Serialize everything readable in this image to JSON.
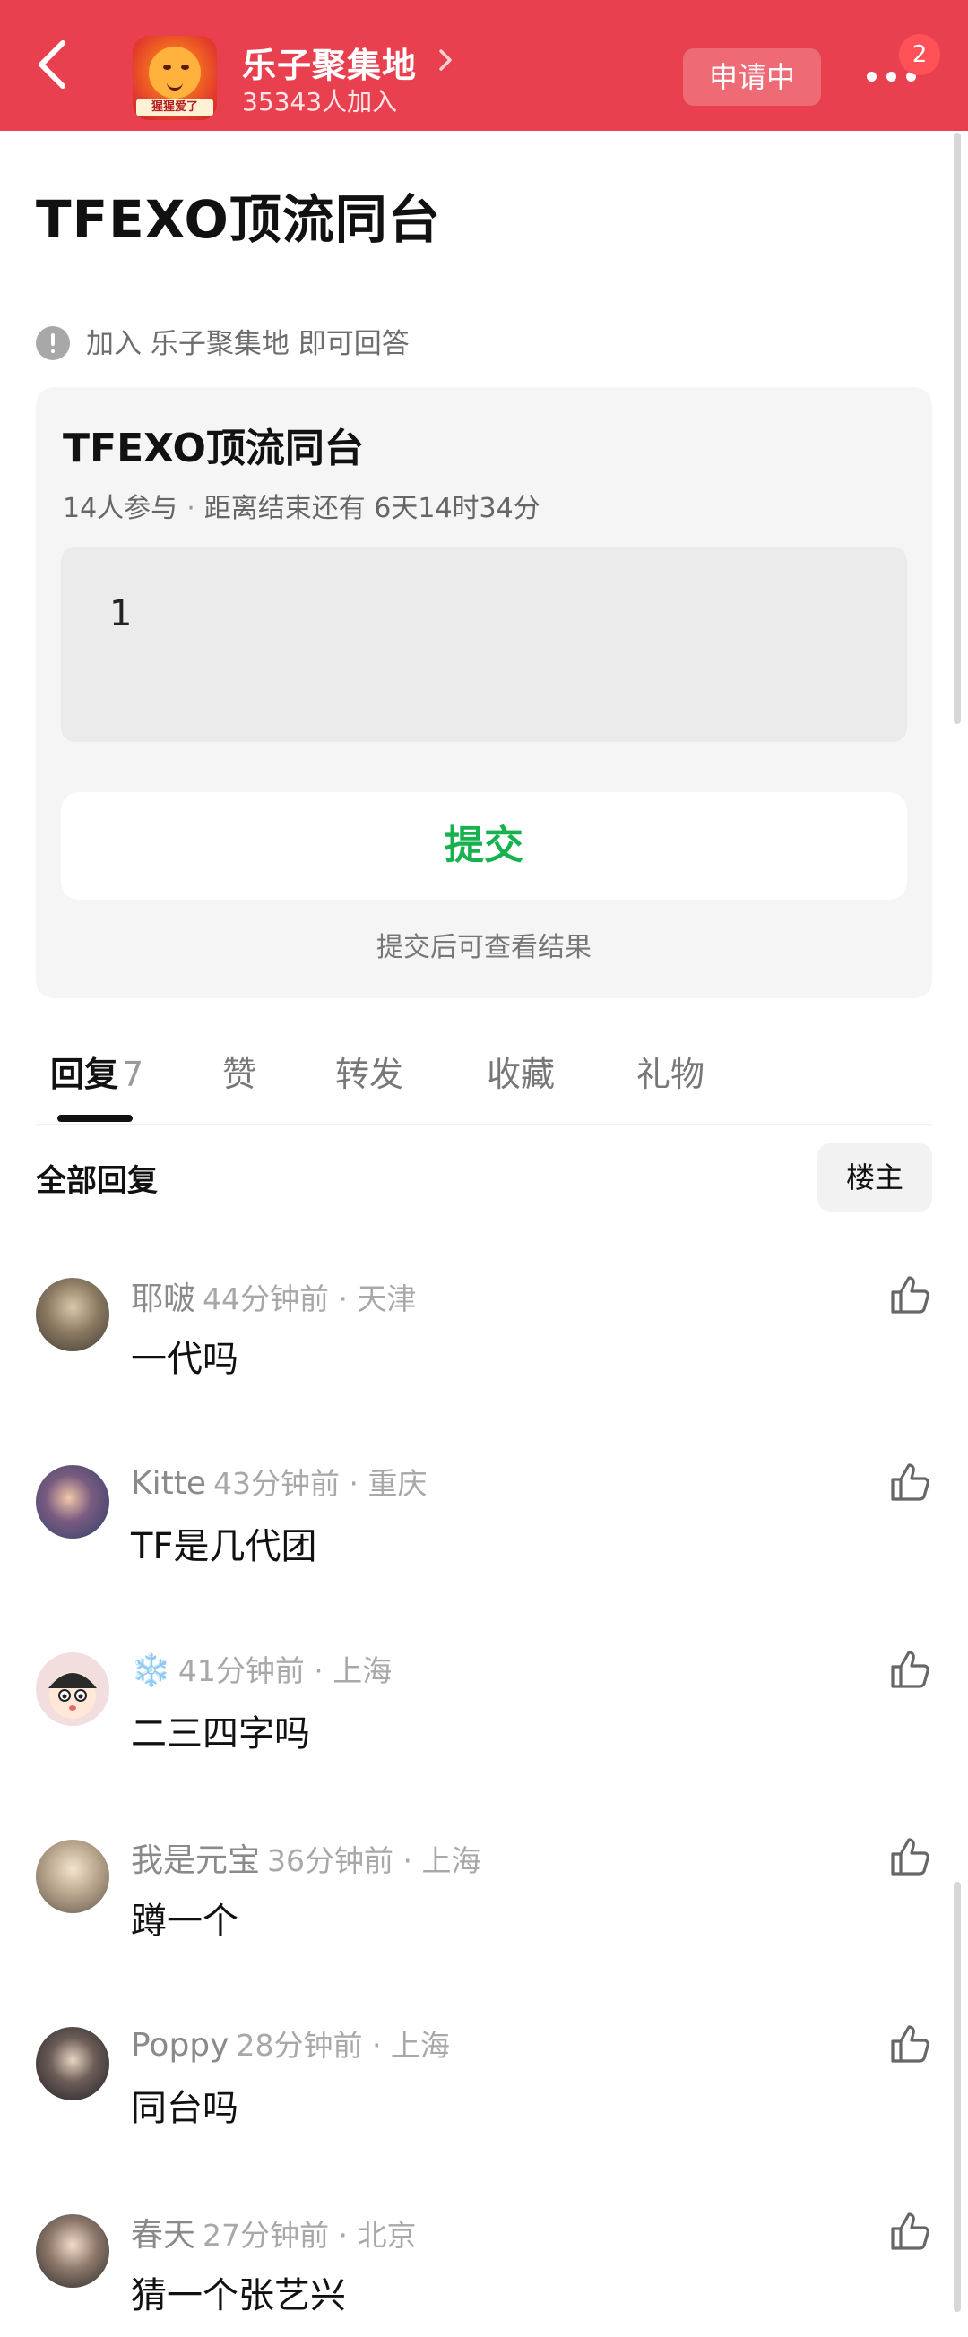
{
  "header": {
    "group_name": "乐子聚集地",
    "members": "35343人加入",
    "avatar_tag": "猩猩爱了",
    "apply_label": "申请中",
    "notification_count": "2",
    "background_color": "#e9404f"
  },
  "post": {
    "title": "TFEXO顶流同台",
    "notice": "加入 乐子聚集地 即可回答"
  },
  "poll": {
    "title": "TFEXO顶流同台",
    "participants": "14人参与",
    "separator": "·",
    "deadline": "距离结束还有 6天14时34分",
    "option": "1",
    "submit_label": "提交",
    "submit_hint": "提交后可查看结果",
    "accent_color": "#17b14f"
  },
  "tabs": [
    {
      "label": "回复",
      "count": "7"
    },
    {
      "label": "赞"
    },
    {
      "label": "转发"
    },
    {
      "label": "收藏"
    },
    {
      "label": "礼物"
    }
  ],
  "replies": {
    "heading": "全部回复",
    "owner_filter": "楼主",
    "items": [
      {
        "name": "耶啵",
        "meta": "44分钟前 · 天津",
        "text": "一代吗"
      },
      {
        "name": "Kitte",
        "meta": "43分钟前 · 重庆",
        "text": "TF是几代团"
      },
      {
        "name": "❄️",
        "meta": "41分钟前 · 上海",
        "text": "二三四字吗"
      },
      {
        "name": "我是元宝",
        "meta": "36分钟前 · 上海",
        "text": "蹲一个"
      },
      {
        "name": "Poppy",
        "meta": "28分钟前 · 上海",
        "text": "同台吗"
      },
      {
        "name": "春天",
        "meta": "27分钟前 · 北京",
        "text": "猜一个张艺兴"
      }
    ]
  }
}
